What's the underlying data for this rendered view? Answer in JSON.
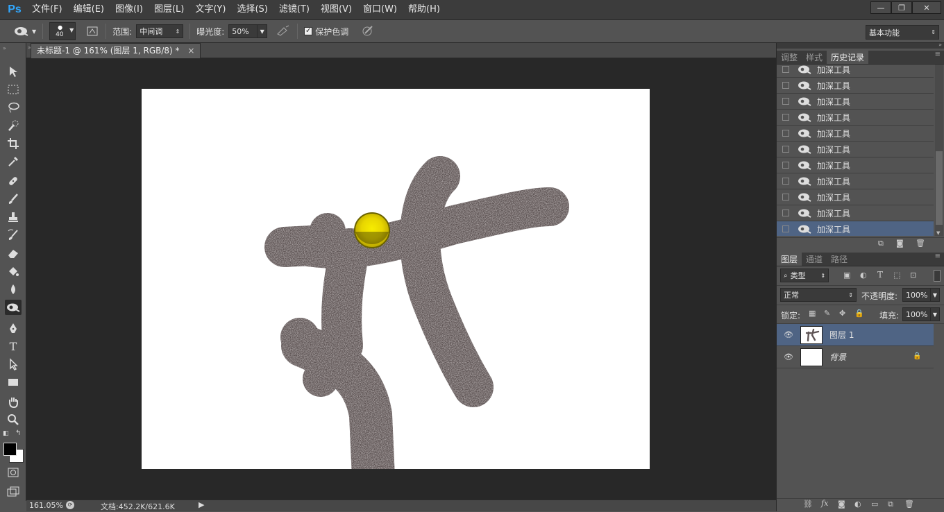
{
  "app": {
    "logo": "Ps"
  },
  "menu": [
    "文件(F)",
    "编辑(E)",
    "图像(I)",
    "图层(L)",
    "文字(Y)",
    "选择(S)",
    "滤镜(T)",
    "视图(V)",
    "窗口(W)",
    "帮助(H)"
  ],
  "window_controls": {
    "minimize": "—",
    "restore": "❐",
    "close": "✕"
  },
  "options": {
    "brush_size": "40",
    "range_label": "范围:",
    "range_value": "中间调",
    "exposure_label": "曝光度:",
    "exposure_value": "50%",
    "protect_tones_label": "保护色调",
    "protect_tones_checked": true,
    "workspace": "基本功能"
  },
  "document": {
    "tab_title": "未标题-1 @ 161% (图层 1, RGB/8) *",
    "close": "×"
  },
  "status": {
    "zoom": "161.05%",
    "doc_info": "文档:452.2K/621.6K"
  },
  "history_panel": {
    "tabs": [
      "调整",
      "样式",
      "历史记录"
    ],
    "active_tab": "历史记录",
    "items": [
      "加深工具",
      "加深工具",
      "加深工具",
      "加深工具",
      "加深工具",
      "加深工具",
      "加深工具",
      "加深工具",
      "加深工具",
      "加深工具",
      "加深工具"
    ],
    "selected_index": 10
  },
  "layers_panel": {
    "tabs": [
      "图层",
      "通道",
      "路径"
    ],
    "active_tab": "图层",
    "filter_kind": "类型",
    "blend_mode": "正常",
    "opacity_label": "不透明度:",
    "opacity_value": "100%",
    "lock_label": "锁定:",
    "fill_label": "填充:",
    "fill_value": "100%",
    "layers": [
      {
        "name": "图层 1",
        "selected": true
      },
      {
        "name": "背景",
        "selected": false,
        "locked": true
      }
    ]
  },
  "colors": {
    "accent": "#31a8ff",
    "selection": "#4f6484",
    "canvas_bg": "#282828",
    "panel_bg": "#535353",
    "brush_cursor": "#f2e600"
  }
}
